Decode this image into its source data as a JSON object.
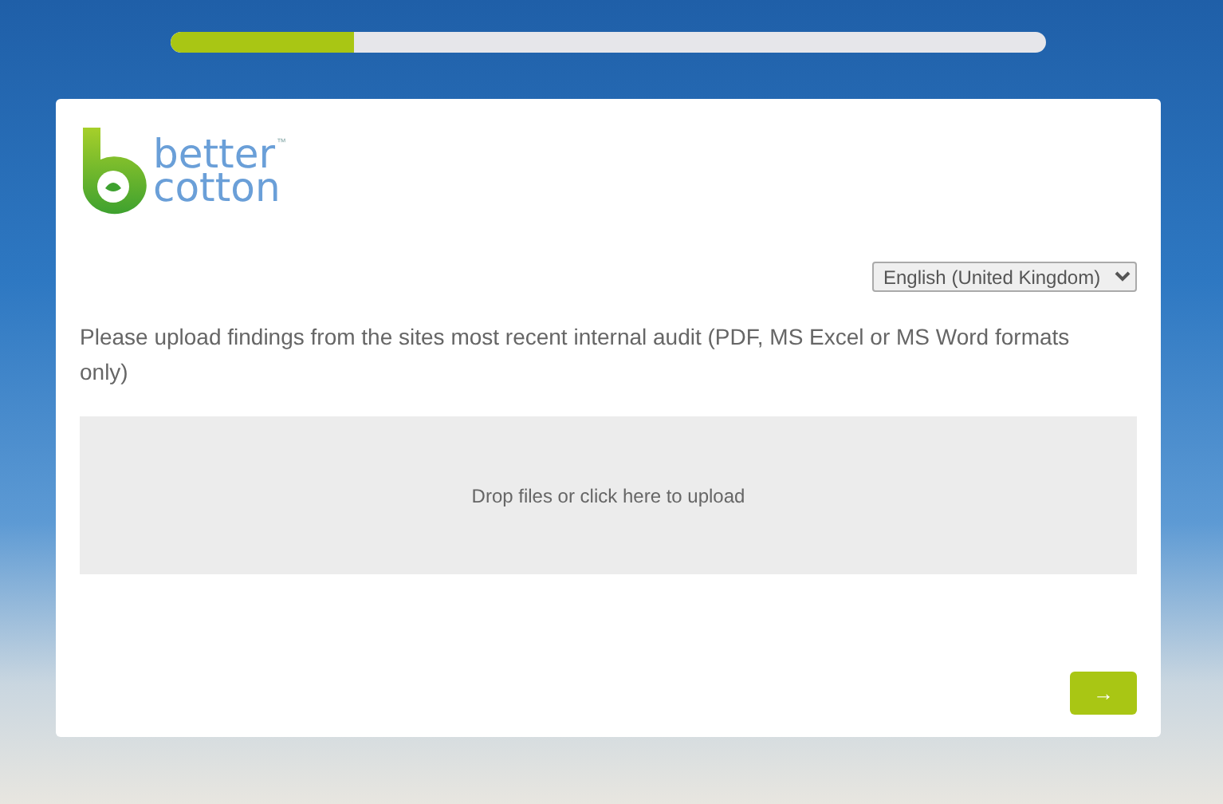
{
  "progress": {
    "level": 0.21
  },
  "logo": {
    "line_1": "better",
    "line_2": "cotton",
    "mark": "™"
  },
  "language_select": {
    "value": "English (United Kingdom)"
  },
  "question": "Please upload findings from the sites most recent internal audit (PDF, MS Excel or MS Word formats only)",
  "upload_zone": {
    "text": "Drop files or click here to upload"
  },
  "next_button": {
    "label": "→"
  }
}
